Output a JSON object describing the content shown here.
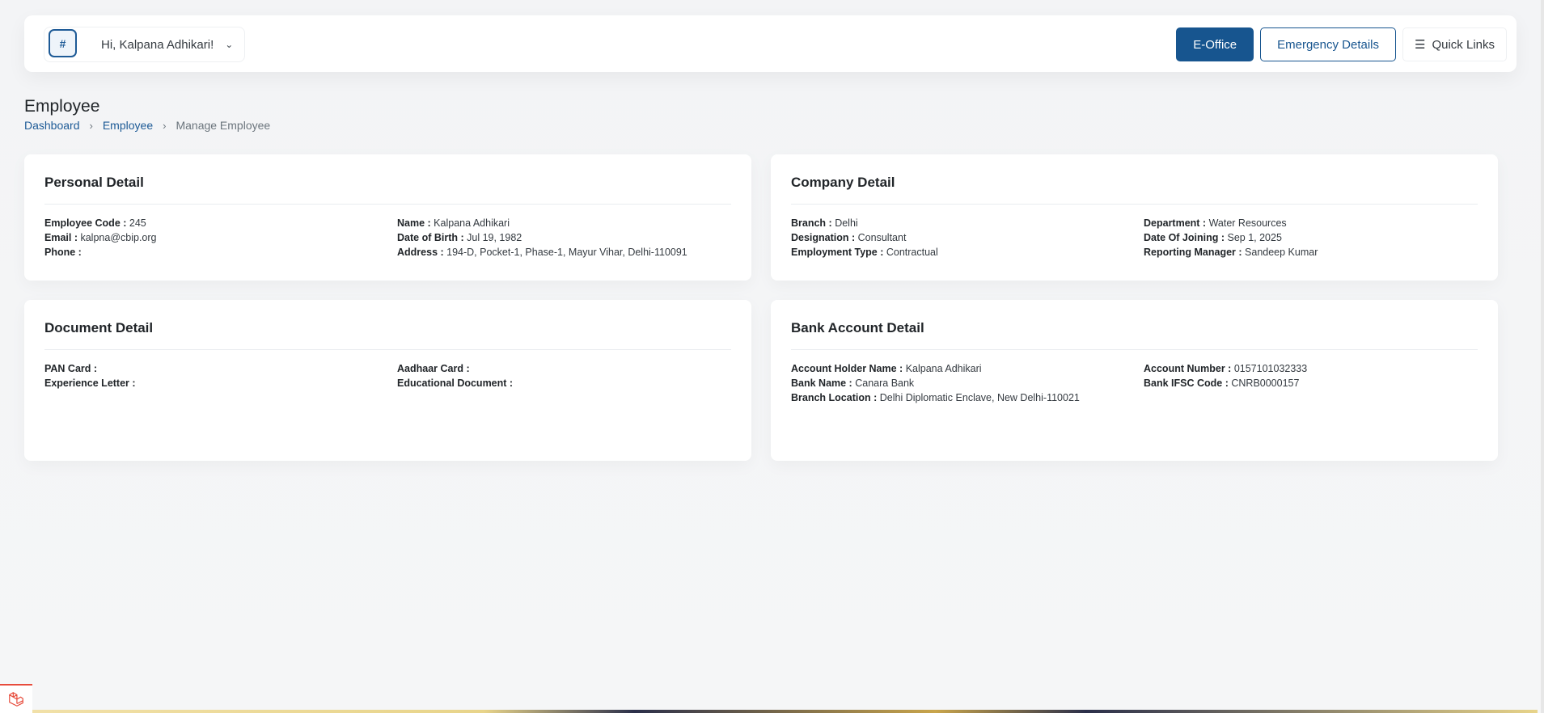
{
  "header": {
    "avatar_alt": "#",
    "greeting": "Hi, Kalpana Adhikari!",
    "buttons": {
      "eoffice": "E-Office",
      "emergency": "Emergency Details",
      "quick_links": "Quick Links"
    }
  },
  "page": {
    "title": "Employee",
    "breadcrumb": [
      "Dashboard",
      "Employee",
      "Manage Employee"
    ]
  },
  "personal": {
    "title": "Personal Detail",
    "employee_code_label": "Employee Code :",
    "employee_code": "245",
    "email_label": "Email :",
    "email": "kalpna@cbip.org",
    "phone_label": "Phone :",
    "phone": "",
    "name_label": "Name :",
    "name": "Kalpana Adhikari",
    "dob_label": "Date of Birth :",
    "dob": "Jul 19, 1982",
    "address_label": "Address :",
    "address": "194-D, Pocket-1, Phase-1, Mayur Vihar, Delhi-110091"
  },
  "company": {
    "title": "Company Detail",
    "branch_label": "Branch :",
    "branch": "Delhi",
    "designation_label": "Designation :",
    "designation": "Consultant",
    "employment_type_label": "Employment Type :",
    "employment_type": "Contractual",
    "department_label": "Department :",
    "department": "Water Resources",
    "doj_label": "Date Of Joining :",
    "doj": "Sep 1, 2025",
    "manager_label": "Reporting Manager :",
    "manager": "Sandeep Kumar"
  },
  "document": {
    "title": "Document Detail",
    "pan_label": "PAN Card :",
    "experience_label": "Experience Letter :",
    "aadhaar_label": "Aadhaar Card :",
    "educational_label": "Educational Document :"
  },
  "bank": {
    "title": "Bank Account Detail",
    "holder_label": "Account Holder Name :",
    "holder": "Kalpana Adhikari",
    "bank_name_label": "Bank Name :",
    "bank_name": "Canara Bank",
    "branch_location_label": "Branch Location :",
    "branch_location": "Delhi Diplomatic Enclave, New Delhi-110021",
    "account_number_label": "Account Number :",
    "account_number": "0157101032333",
    "ifsc_label": "Bank IFSC Code :",
    "ifsc": "CNRB0000157"
  },
  "icons": {
    "chevron": "chevron-down-icon",
    "list": "list-icon",
    "laravel": "laravel-icon"
  },
  "colors": {
    "primary": "#17558f",
    "link": "#1d5a96",
    "background": "#f3f4f6"
  }
}
